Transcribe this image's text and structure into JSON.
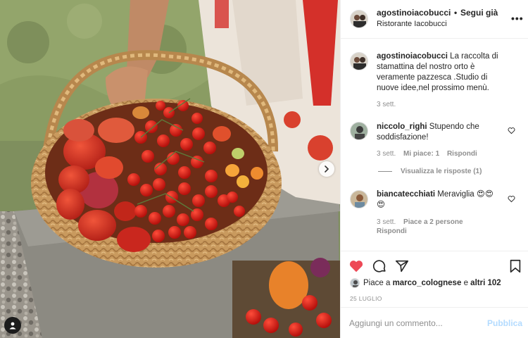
{
  "post": {
    "username": "agostinoiacobucci",
    "separator": "•",
    "follow_label": "Segui già",
    "location": "Ristorante Iacobucci",
    "more_icon": "more-icon",
    "more_glyph": "•••"
  },
  "photo": {
    "next_icon": "chevron-right-icon",
    "user_tag_icon": "user-tag-icon"
  },
  "caption": {
    "username": "agostinoiacobucci",
    "text": "La raccolta di stamattina del nostro orto è veramente pazzesca .Studio di nuove idee,nel prossimo menù.",
    "time": "3 sett."
  },
  "comments": [
    {
      "username": "niccolo_righi",
      "text": "Stupendo che soddisfazione!",
      "time": "3 sett.",
      "likes": "Mi piace: 1",
      "reply": "Rispondi",
      "view_replies": "Visualizza le risposte (1)"
    },
    {
      "username": "biancatecchiati",
      "text": "Meraviglia 😍😍",
      "text_extra": "😍",
      "time": "3 sett.",
      "likes": "Piace a 2 persone",
      "reply": "Rispondi"
    }
  ],
  "actions": {
    "like_icon": "heart-filled-icon",
    "comment_icon": "comment-icon",
    "share_icon": "share-icon",
    "save_icon": "bookmark-icon",
    "liked_prefix": "Piace a",
    "liked_by": "marco_colognese",
    "liked_suffix": "e",
    "liked_others": "altri 102",
    "date": "25 LUGLIO"
  },
  "add_comment": {
    "placeholder": "Aggiungi un commento...",
    "publish_label": "Pubblica"
  },
  "colors": {
    "like_red": "#ed4956",
    "publish_blue": "#b3dbff",
    "muted_gray": "#8e8e8e"
  }
}
